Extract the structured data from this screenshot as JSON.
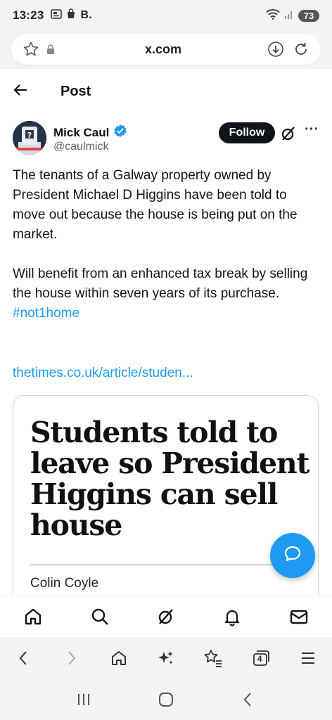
{
  "status": {
    "time": "13:23",
    "carrier": "B.",
    "battery": "73"
  },
  "browser": {
    "url": "x.com"
  },
  "header": {
    "title": "Post"
  },
  "post": {
    "author_name": "Mick Caul",
    "author_handle": "@caulmick",
    "follow_label": "Follow",
    "text_p1": "The tenants of a Galway property owned by President Michael D Higgins have been told to move out because the house is being put on the market.",
    "text_p2": "Will benefit from an enhanced tax break by selling the house within seven years of its purchase.",
    "hashtag": "#not1home",
    "link": "thetimes.co.uk/article/studen..."
  },
  "card": {
    "headline": "Students told to leave so President Higgins can sell house",
    "author": "Colin Coyle"
  },
  "colors": {
    "accent": "#1d9bf0",
    "text": "#0f1419",
    "muted": "#536471"
  },
  "icons": {
    "app_nav": [
      "home-icon",
      "search-icon",
      "grok-icon",
      "bell-icon",
      "mail-icon"
    ],
    "browser_nav": [
      "back-icon",
      "forward-icon",
      "home-icon",
      "sparkle-icon",
      "bookmarks-icon",
      "tabs-icon",
      "menu-icon"
    ]
  },
  "tabs_count": "4"
}
